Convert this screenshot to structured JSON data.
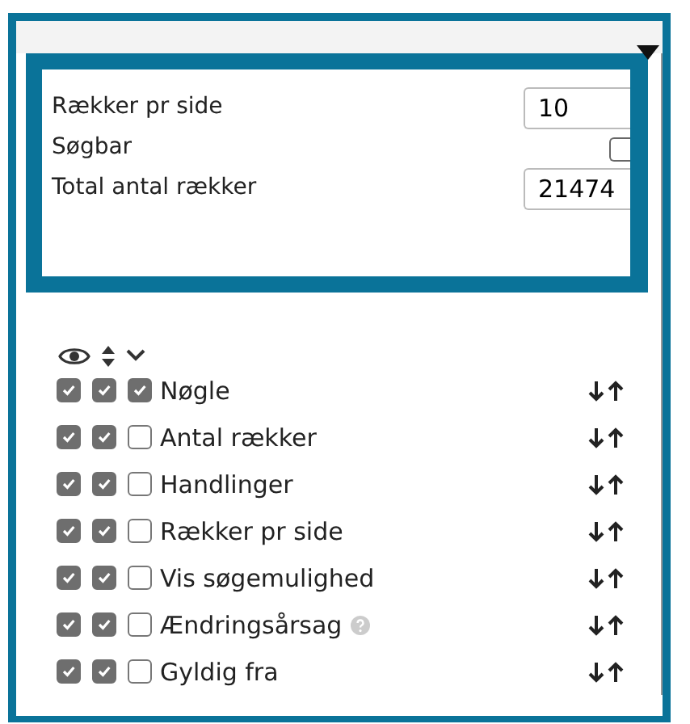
{
  "settings": [
    {
      "kind": "input",
      "label": "Rækker pr side",
      "value": "10"
    },
    {
      "kind": "checkbox",
      "label": "Søgbar",
      "checked": false
    },
    {
      "kind": "input",
      "label": "Total antal rækker",
      "value": "21474"
    }
  ],
  "columns": [
    {
      "label": "Nøgle",
      "visible": true,
      "sortable": true,
      "expanded": true,
      "help": false
    },
    {
      "label": "Antal rækker",
      "visible": true,
      "sortable": true,
      "expanded": false,
      "help": false
    },
    {
      "label": "Handlinger",
      "visible": true,
      "sortable": true,
      "expanded": false,
      "help": false
    },
    {
      "label": "Rækker pr side",
      "visible": true,
      "sortable": true,
      "expanded": false,
      "help": false
    },
    {
      "label": "Vis søgemulighed",
      "visible": true,
      "sortable": true,
      "expanded": false,
      "help": false
    },
    {
      "label": "Ændringsårsag",
      "visible": true,
      "sortable": true,
      "expanded": false,
      "help": true
    },
    {
      "label": "Gyldig fra",
      "visible": true,
      "sortable": true,
      "expanded": false,
      "help": false
    }
  ]
}
